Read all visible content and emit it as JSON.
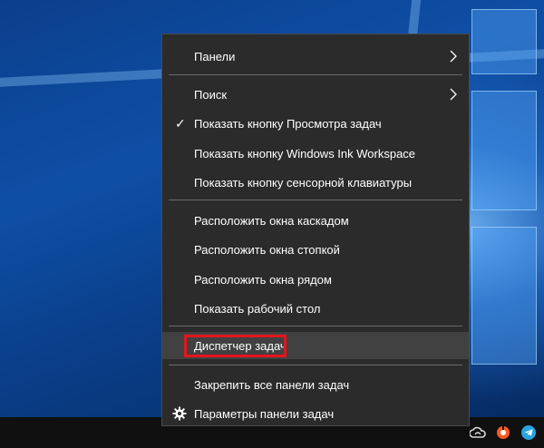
{
  "context_menu": {
    "items": [
      {
        "label": "Панели",
        "submenu": true
      },
      {
        "label": "Поиск",
        "submenu": true
      },
      {
        "label": "Показать кнопку Просмотра задач",
        "checked": true
      },
      {
        "label": "Показать кнопку Windows Ink Workspace"
      },
      {
        "label": "Показать кнопку сенсорной клавиатуры"
      },
      {
        "label": "Расположить окна каскадом"
      },
      {
        "label": "Расположить окна стопкой"
      },
      {
        "label": "Расположить окна рядом"
      },
      {
        "label": "Показать рабочий стол"
      },
      {
        "label": "Диспетчер задач",
        "highlighted": true
      },
      {
        "label": "Закрепить все панели задач"
      },
      {
        "label": "Параметры панели задач",
        "icon": "gear-icon"
      }
    ],
    "highlight_color": "#e3161c"
  },
  "tray": {
    "icons": [
      "creative-cloud-icon",
      "tray-app-icon",
      "telegram-icon"
    ]
  }
}
